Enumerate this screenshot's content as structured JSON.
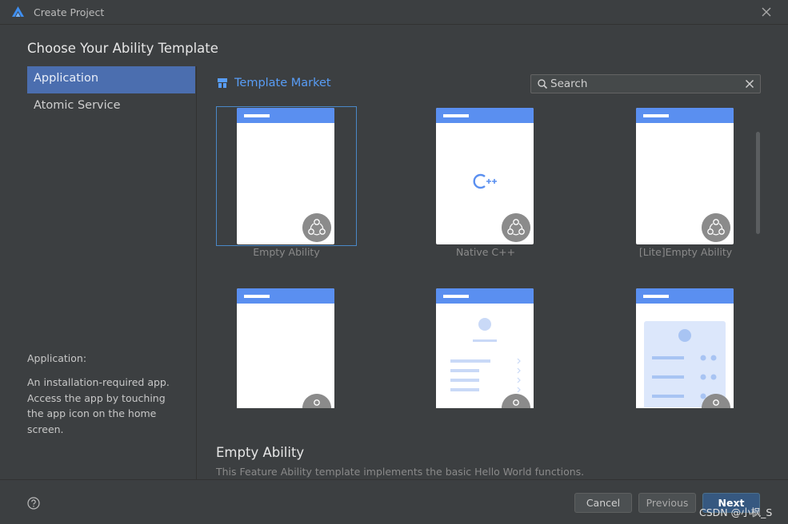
{
  "window": {
    "title": "Create Project"
  },
  "heading": "Choose Your Ability Template",
  "sidebar": {
    "items": [
      {
        "label": "Application",
        "active": true
      },
      {
        "label": "Atomic Service",
        "active": false
      }
    ],
    "description_title": "Application:",
    "description": "An installation-required app. Access the app by touching the app icon on the home screen."
  },
  "main": {
    "market_label": "Template Market",
    "search": {
      "value": "",
      "placeholder": "Search"
    },
    "templates": [
      {
        "label": "Empty Ability",
        "selected": true,
        "preview": "blank"
      },
      {
        "label": "Native C++",
        "selected": false,
        "preview": "cpp"
      },
      {
        "label": "[Lite]Empty Ability",
        "selected": false,
        "preview": "blank"
      },
      {
        "label": "",
        "selected": false,
        "preview": "blank"
      },
      {
        "label": "",
        "selected": false,
        "preview": "list"
      },
      {
        "label": "",
        "selected": false,
        "preview": "grid"
      }
    ],
    "detail": {
      "title": "Empty Ability",
      "description": "This Feature Ability template implements the basic Hello World functions."
    }
  },
  "footer": {
    "cancel_label": "Cancel",
    "previous_label": "Previous",
    "next_label": "Next",
    "watermark": "CSDN @小枫_S"
  },
  "colors": {
    "accent": "#4b6eaf",
    "link": "#589df6",
    "phone_header": "#5a8ff0",
    "background": "#3c3f41"
  },
  "icons": [
    "app-logo-icon",
    "close-icon",
    "template-market-icon",
    "search-icon",
    "clear-icon",
    "ability-badge-icon",
    "help-icon"
  ]
}
